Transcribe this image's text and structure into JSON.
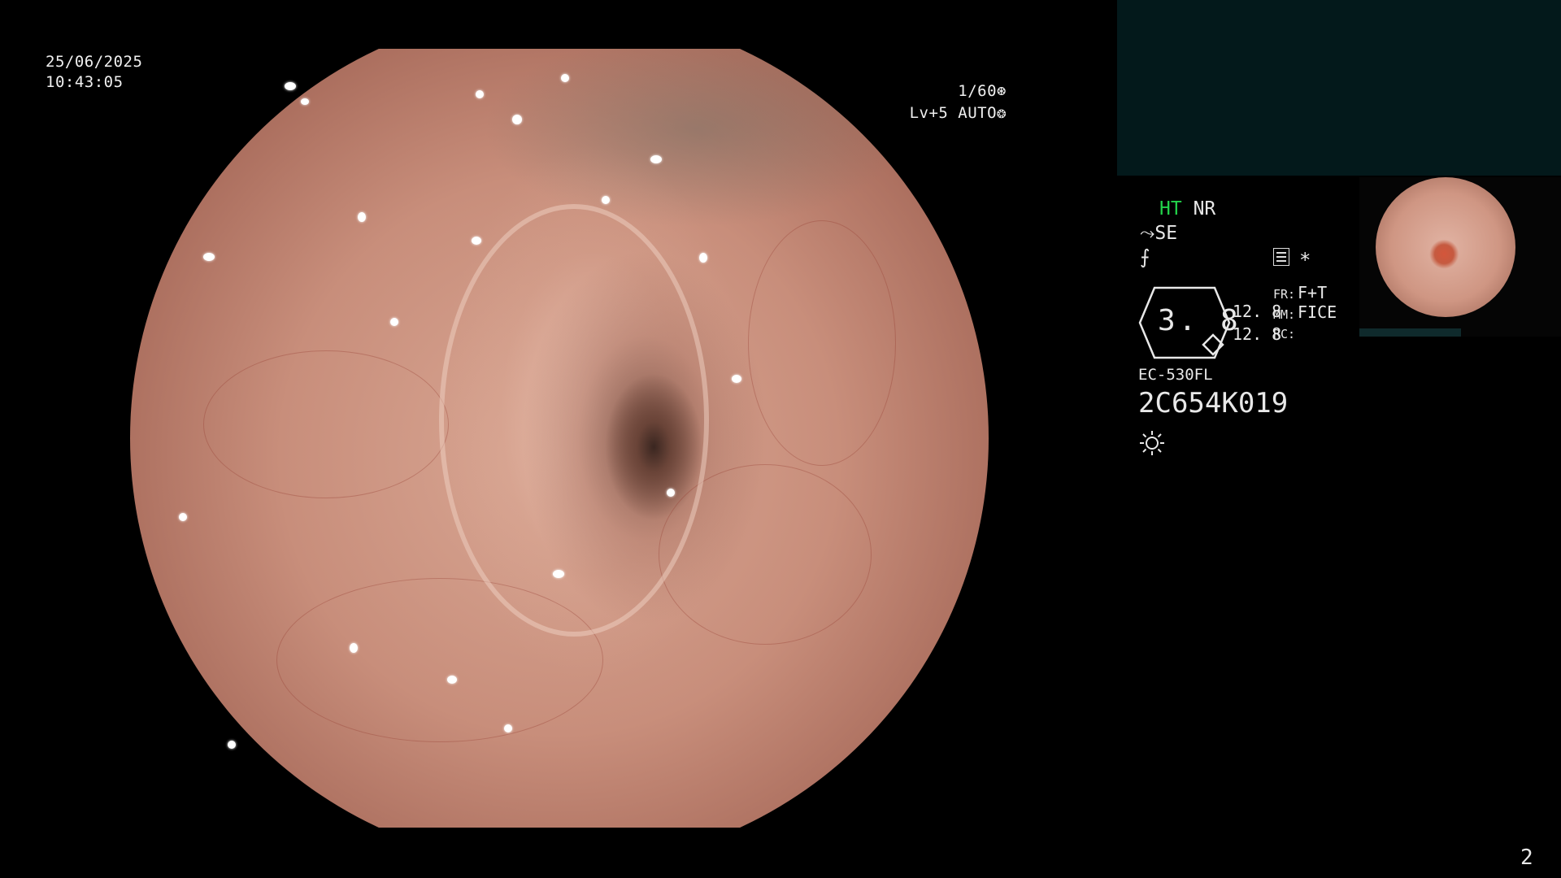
{
  "overlay": {
    "date": "25/06/2025",
    "time": "10:43:05",
    "shutter": "1/60",
    "shutter_icon": "aperture-icon",
    "level": "Lv+5",
    "exposure_mode": "AUTO",
    "exposure_icon": "iris-icon"
  },
  "panel": {
    "ht_label": "HT",
    "nr_label": "NR",
    "se_label": "SE",
    "se_icon": "scope-angle-icon",
    "cut_icon": "cut-mode-icon",
    "menu_icon": "menu-list-icon",
    "star": "*",
    "zoom_value": "3. 8",
    "mm_top": "12. 8",
    "mm_bottom": "12. 8",
    "fr_label": "FR:",
    "fr_value": "F+T",
    "mm_label": "MM:",
    "mm_value": "FICE",
    "rc_label": "RC:",
    "scope_model": "EC-530FL",
    "scope_serial": "2C654K019",
    "light_icon": "light-source-icon"
  },
  "page_number": "2",
  "colors": {
    "ht_green": "#22d34a",
    "panel_teal": "#03191b",
    "background": "#000000"
  }
}
